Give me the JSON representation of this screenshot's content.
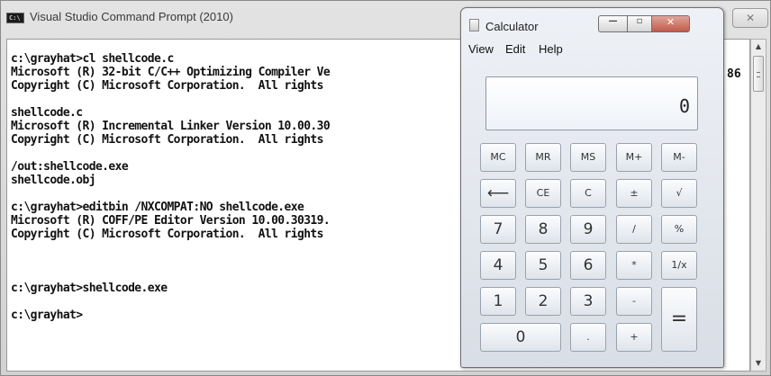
{
  "cmd": {
    "title": "Visual Studio Command Prompt (2010)",
    "icon_text": "C:\\",
    "close_label": "✕",
    "console_lines": [
      "c:\\grayhat>cl shellcode.c",
      "Microsoft (R) 32-bit C/C++ Optimizing Compiler Ve",
      "Copyright (C) Microsoft Corporation.  All rights",
      "",
      "shellcode.c",
      "Microsoft (R) Incremental Linker Version 10.00.30",
      "Copyright (C) Microsoft Corporation.  All rights",
      "",
      "/out:shellcode.exe",
      "shellcode.obj",
      "",
      "c:\\grayhat>editbin /NXCOMPAT:NO shellcode.exe",
      "Microsoft (R) COFF/PE Editor Version 10.00.30319.",
      "Copyright (C) Microsoft Corporation.  All rights",
      "",
      "",
      "",
      "c:\\grayhat>shellcode.exe",
      "",
      "c:\\grayhat>"
    ],
    "peek_text": "86"
  },
  "calc": {
    "title": "Calculator",
    "menu": {
      "view": "View",
      "edit": "Edit",
      "help": "Help"
    },
    "display": "0",
    "window_buttons": {
      "minimize": "—",
      "maximize": "▫",
      "close": "✕"
    },
    "keys": {
      "mc": "MC",
      "mr": "MR",
      "ms": "MS",
      "mplus": "M+",
      "mminus": "M-",
      "backspace": "⟵",
      "ce": "CE",
      "c": "C",
      "plusminus": "±",
      "sqrt": "√",
      "seven": "7",
      "eight": "8",
      "nine": "9",
      "divide": "/",
      "percent": "%",
      "four": "4",
      "five": "5",
      "six": "6",
      "multiply": "*",
      "reciprocal": "1/x",
      "one": "1",
      "two": "2",
      "three": "3",
      "minus": "-",
      "equals": "=",
      "zero": "0",
      "decimal": ".",
      "plus": "+"
    }
  }
}
